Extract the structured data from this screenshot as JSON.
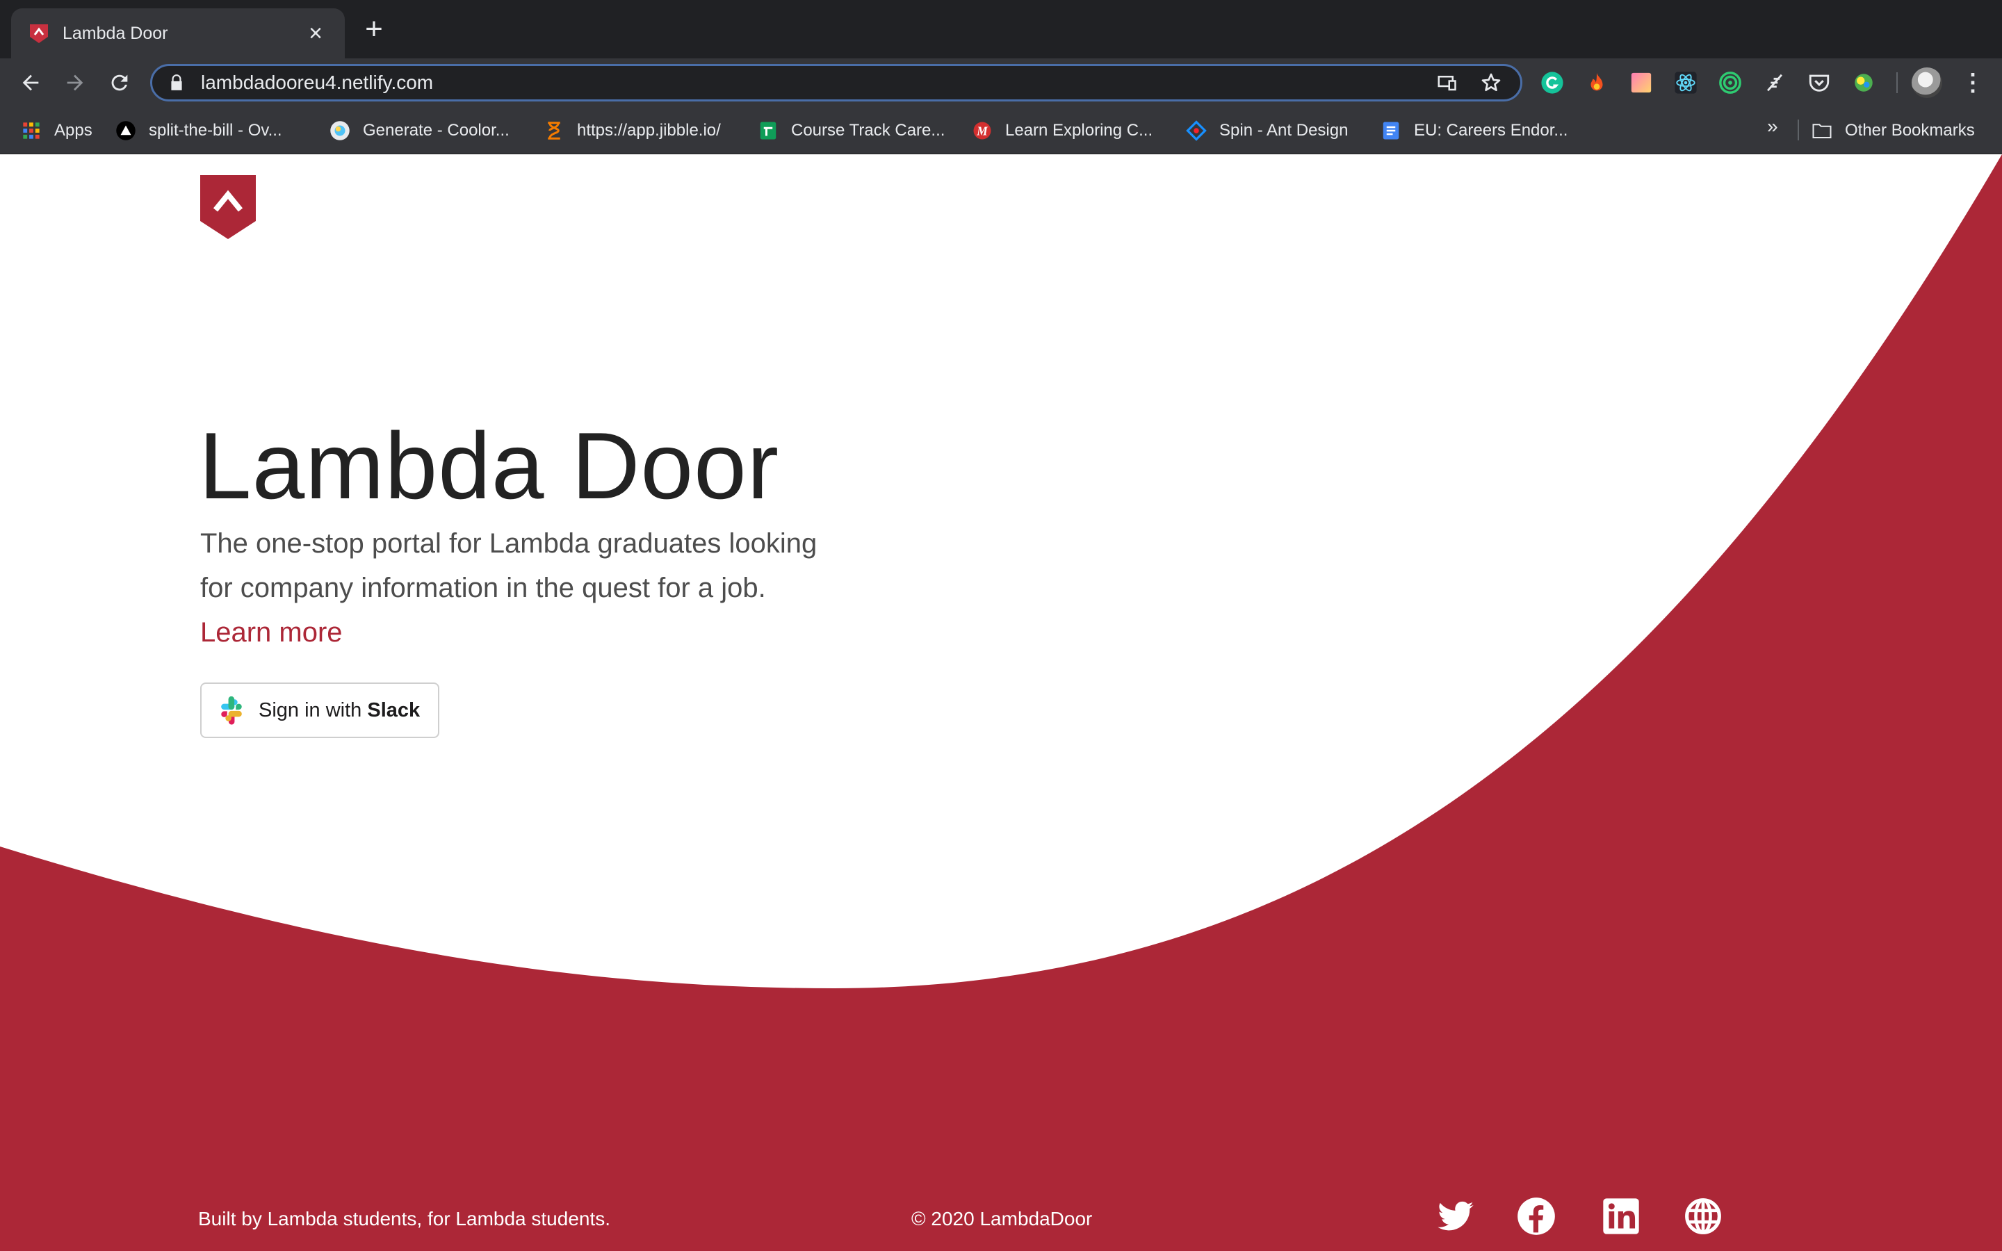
{
  "browser": {
    "tab": {
      "title": "Lambda Door",
      "favicon": "lambda-shield-icon"
    },
    "url": "lambdadooreu4.netlify.com",
    "bookmarks": [
      {
        "label": "Apps",
        "icon": "apps-grid-icon"
      },
      {
        "label": "split-the-bill - Ov...",
        "icon": "triangle-icon"
      },
      {
        "label": "Generate - Coolor...",
        "icon": "coolors-icon"
      },
      {
        "label": "https://app.jibble.io/",
        "icon": "hourglass-icon"
      },
      {
        "label": "Course Track Care...",
        "icon": "sheets-icon"
      },
      {
        "label": "Learn Exploring C...",
        "icon": "m-logo-icon"
      },
      {
        "label": "Spin - Ant Design",
        "icon": "ant-design-icon"
      },
      {
        "label": "EU: Careers Endor...",
        "icon": "docs-icon"
      }
    ],
    "more_bookmarks": "»",
    "other_bookmarks": "Other Bookmarks"
  },
  "page": {
    "title": "Lambda Door",
    "description": "The one-stop portal for Lambda graduates looking for company information in the quest for a job.",
    "learn_more": "Learn more",
    "slack_prefix": "Sign in with ",
    "slack_brand": "Slack",
    "footer_left": "Built by Lambda students, for Lambda students.",
    "footer_center": "© 2020 LambdaDoor",
    "social": [
      "twitter-icon",
      "facebook-icon",
      "linkedin-icon",
      "globe-icon"
    ]
  },
  "colors": {
    "brand": "#ac2737",
    "chrome_dark": "#202124",
    "chrome": "#35363a"
  }
}
